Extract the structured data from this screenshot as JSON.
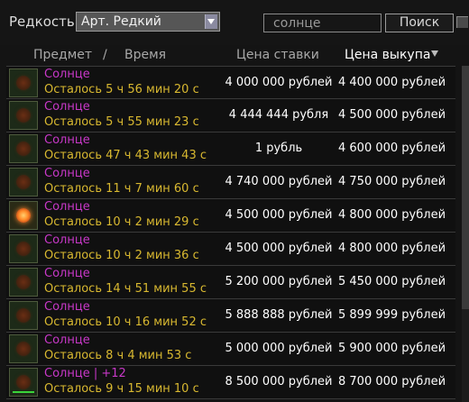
{
  "filter": {
    "rarity_label": "Редкость",
    "rarity_value": "Арт. Редкий",
    "search_value": "солнце",
    "search_button": "Поиск"
  },
  "columns": {
    "item": "Предмет",
    "separator": "/",
    "time": "Время",
    "bid": "Цена ставки",
    "buyout": "Цена выкупа"
  },
  "rows": [
    {
      "name": "Солнце",
      "time": "Осталось 5 ч 56 мин 20 с",
      "bid": "4 000 000 рублей",
      "buyout": "4 400 000 рублей"
    },
    {
      "name": "Солнце",
      "time": "Осталось 5 ч 55 мин 23 с",
      "bid": "4 444 444 рубля",
      "buyout": "4 500 000 рублей"
    },
    {
      "name": "Солнце",
      "time": "Осталось 47 ч 43 мин 43 с",
      "bid": "1 рубль",
      "buyout": "4 600 000 рублей"
    },
    {
      "name": "Солнце",
      "time": "Осталось 11 ч 7 мин 60 с",
      "bid": "4 740 000 рублей",
      "buyout": "4 750 000 рублей"
    },
    {
      "name": "Солнце",
      "time": "Осталось 10 ч 2 мин 29 с",
      "bid": "4 500 000 рублей",
      "buyout": "4 800 000 рублей"
    },
    {
      "name": "Солнце",
      "time": "Осталось 10 ч 2 мин 36 с",
      "bid": "4 500 000 рублей",
      "buyout": "4 800 000 рублей"
    },
    {
      "name": "Солнце",
      "time": "Осталось 14 ч 51 мин 55 с",
      "bid": "5 200 000 рублей",
      "buyout": "5 450 000 рублей"
    },
    {
      "name": "Солнце",
      "time": "Осталось 10 ч 16 мин 52 с",
      "bid": "5 888 888 рублей",
      "buyout": "5 899 999 рублей"
    },
    {
      "name": "Солнце",
      "time": "Осталось 8 ч 4 мин 53 с",
      "bid": "5 000 000 рублей",
      "buyout": "5 900 000 рублей"
    },
    {
      "name": "Солнце | +12",
      "time": "Осталось 9 ч 15 мин 10 с",
      "bid": "8 500 000 рублей",
      "buyout": "8 700 000 рублей"
    }
  ],
  "colors": {
    "item_name": "#c838c8",
    "time_left": "#d8b830",
    "price": "#ffffff",
    "background": "#141414"
  }
}
